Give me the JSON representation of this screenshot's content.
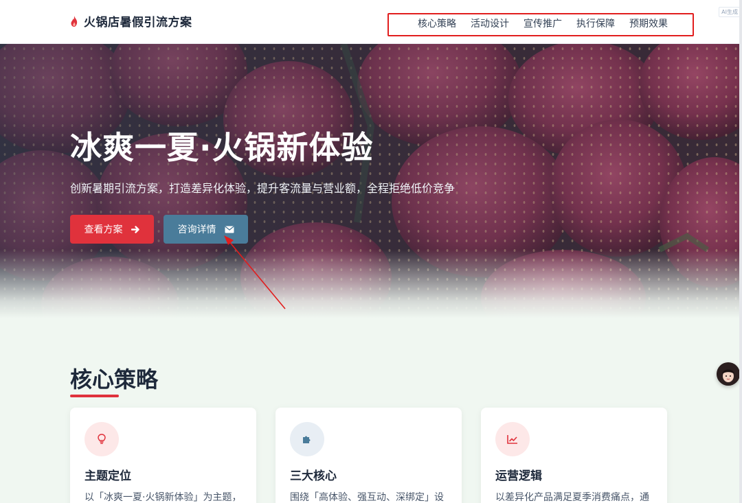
{
  "header": {
    "brand_title": "火锅店暑假引流方案",
    "brand_icon": "flame-icon",
    "nav": [
      {
        "label": "核心策略"
      },
      {
        "label": "活动设计"
      },
      {
        "label": "宣传推广"
      },
      {
        "label": "执行保障"
      },
      {
        "label": "预期效果"
      }
    ],
    "ai_badge": "AI生成"
  },
  "hero": {
    "title": "冰爽一夏·火锅新体验",
    "subtitle": "创新暑期引流方案，打造差异化体验，提升客流量与营业额，全程拒绝低价竞争",
    "primary_button": {
      "label": "查看方案",
      "icon": "arrow-right-icon"
    },
    "secondary_button": {
      "label": "咨询详情",
      "icon": "envelope-icon"
    }
  },
  "core": {
    "title": "核心策略",
    "cards": [
      {
        "title": "主题定位",
        "desc": "以「冰爽一夏·火锅新体验」为主题，",
        "icon": "lightbulb-icon"
      },
      {
        "title": "三大核心",
        "desc": "围绕「高体验、强互动、深绑定」设",
        "icon": "puzzle-icon"
      },
      {
        "title": "运营逻辑",
        "desc": "以差异化产品满足夏季消费痛点，通",
        "icon": "chart-line-icon"
      }
    ]
  },
  "colors": {
    "accent_red": "#e0323c",
    "accent_blue": "#4a7c9a",
    "dark_text": "#1e293b"
  }
}
